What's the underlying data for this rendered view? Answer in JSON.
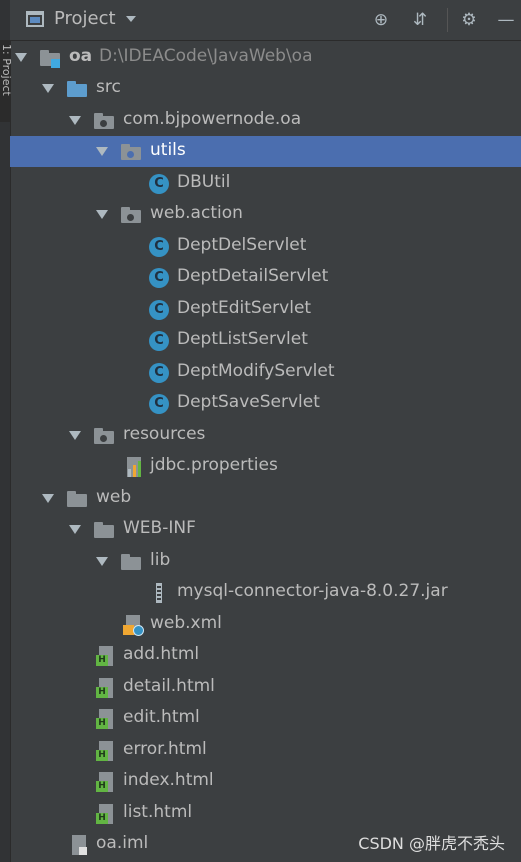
{
  "sidebar": {
    "tab_label": "1: Project"
  },
  "header": {
    "title": "Project",
    "buttons": {
      "locate": "⊕",
      "collapse": "⇵",
      "settings": "⚙",
      "hide": "—"
    }
  },
  "tree": {
    "root": {
      "name": "oa",
      "path": "D:\\IDEACode\\JavaWeb\\oa"
    },
    "src": "src",
    "pkg": "com.bjpowernode.oa",
    "utils": "utils",
    "dbutil": "DBUtil",
    "web_action": "web.action",
    "servlets": [
      "DeptDelServlet",
      "DeptDetailServlet",
      "DeptEditServlet",
      "DeptListServlet",
      "DeptModifyServlet",
      "DeptSaveServlet"
    ],
    "resources": "resources",
    "jdbc": "jdbc.properties",
    "web": "web",
    "webinf": "WEB-INF",
    "lib": "lib",
    "jar": "mysql-connector-java-8.0.27.jar",
    "webxml": "web.xml",
    "htmls": [
      "add.html",
      "detail.html",
      "edit.html",
      "error.html",
      "index.html",
      "list.html"
    ],
    "iml": "oa.iml",
    "class_glyph": "C",
    "html_glyph": "H"
  },
  "watermark": "CSDN @胖虎不秃头",
  "colors": {
    "background": "#3c3f41",
    "selection": "#4b6eaf",
    "source_folder": "#5d9dce",
    "class_icon": "#3592c4",
    "html_icon": "#62b543"
  },
  "icons": {
    "module": "module-folder-icon",
    "source": "source-folder-icon",
    "package": "package-icon",
    "class": "java-class-icon",
    "html": "html-file-icon",
    "jar": "jar-file-icon",
    "xml": "xml-file-icon",
    "properties": "properties-file-icon"
  }
}
